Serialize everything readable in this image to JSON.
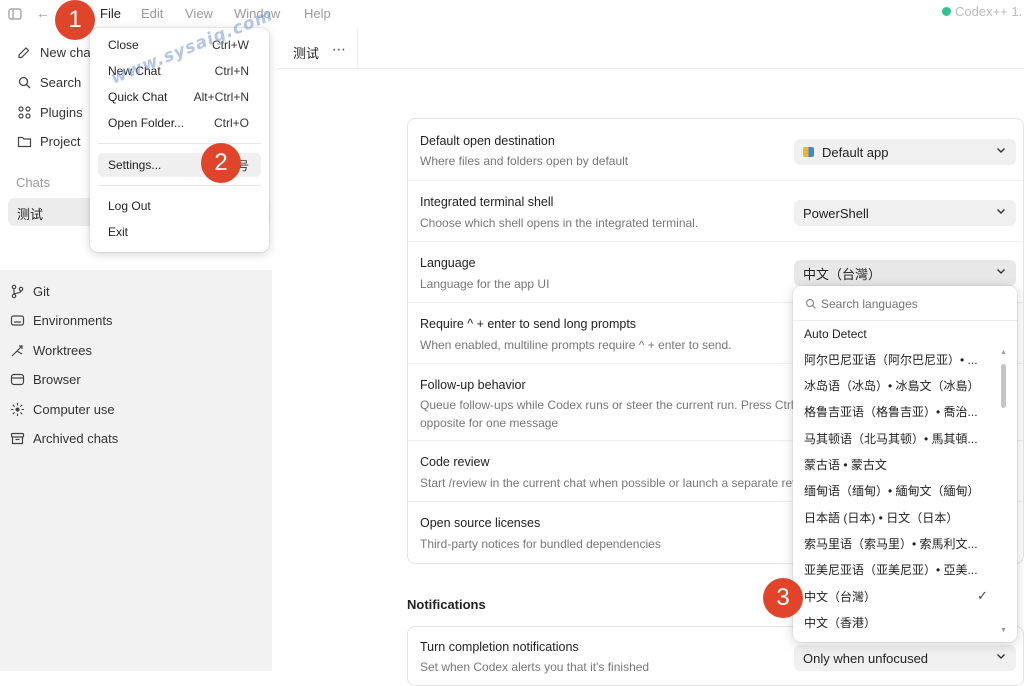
{
  "titlebar": {
    "menus": [
      "File",
      "Edit",
      "View",
      "Window",
      "Help"
    ],
    "app_status": "Codex++ 1."
  },
  "sidebar": {
    "top_items": [
      {
        "label": "New chat",
        "icon": "compose-icon"
      },
      {
        "label": "Search",
        "icon": "search-icon"
      },
      {
        "label": "Plugins",
        "icon": "plugins-icon"
      },
      {
        "label": "Project",
        "icon": "project-icon"
      }
    ],
    "chats_heading": "Chats",
    "chat_item": "测试",
    "lower_items": [
      {
        "label": "Git",
        "icon": "git-icon"
      },
      {
        "label": "Environments",
        "icon": "environments-icon"
      },
      {
        "label": "Worktrees",
        "icon": "worktrees-icon"
      },
      {
        "label": "Browser",
        "icon": "browser-icon"
      },
      {
        "label": "Computer use",
        "icon": "computer-use-icon"
      },
      {
        "label": "Archived chats",
        "icon": "archive-icon"
      }
    ]
  },
  "tab": {
    "title": "测试",
    "more": "⋯"
  },
  "file_menu": {
    "items": [
      {
        "label": "Close",
        "shortcut": "Ctrl+W"
      },
      {
        "label": "New Chat",
        "shortcut": "Ctrl+N"
      },
      {
        "label": "Quick Chat",
        "shortcut": "Alt+Ctrl+N"
      },
      {
        "label": "Open Folder...",
        "shortcut": "Ctrl+O"
      },
      {
        "label": "Settings...",
        "shortcut": "号"
      },
      {
        "label": "Log Out",
        "shortcut": ""
      },
      {
        "label": "Exit",
        "shortcut": ""
      }
    ]
  },
  "settings": {
    "rows": [
      {
        "title": "Default open destination",
        "desc": "Where files and folders open by default",
        "value": "Default app"
      },
      {
        "title": "Integrated terminal shell",
        "desc": "Choose which shell opens in the integrated terminal.",
        "value": "PowerShell"
      },
      {
        "title": "Language",
        "desc": "Language for the app UI",
        "value": "中文（台灣）"
      },
      {
        "title": "Require ^ + enter to send long prompts",
        "desc": "When enabled, multiline prompts require ^ + enter to send."
      },
      {
        "title": "Follow-up behavior",
        "desc": "Queue follow-ups while Codex runs or steer the current run. Press Ctrl+",
        "desc2": "opposite for one message"
      },
      {
        "title": "Code review",
        "desc": "Start /review in the current chat when possible or launch a separate rev"
      },
      {
        "title": "Open source licenses",
        "desc": "Third-party notices for bundled dependencies"
      }
    ],
    "notifications_heading": "Notifications",
    "notif_row": {
      "title": "Turn completion notifications",
      "desc": "Set when Codex alerts you that it's finished",
      "value": "Only when unfocused"
    }
  },
  "language_dropdown": {
    "search_placeholder": "Search languages",
    "options": [
      "Auto Detect",
      "阿尔巴尼亚语（阿尔巴尼亚）• ...",
      "冰岛语（冰岛）• 冰島文（冰島）",
      "格鲁吉亚语（格鲁吉亚）• 喬治...",
      "马其顿语（北马其顿）• 馬其頓...",
      "蒙古语 • 蒙古文",
      "缅甸语（缅甸）• 緬甸文（緬甸）",
      "日本語 (日本) • 日文（日本）",
      "索马里语（索马里）• 索馬利文...",
      "亚美尼亚语（亚美尼亚）• 亞美...",
      "中文（台灣）",
      "中文（香港）"
    ],
    "selected": "中文（台灣）",
    "check": "✓"
  },
  "badges": [
    "1",
    "2",
    "3"
  ],
  "watermark": "www.sysaig.com",
  "colors": {
    "badge": "#e0452b",
    "status_dot": "#2fc48d"
  }
}
